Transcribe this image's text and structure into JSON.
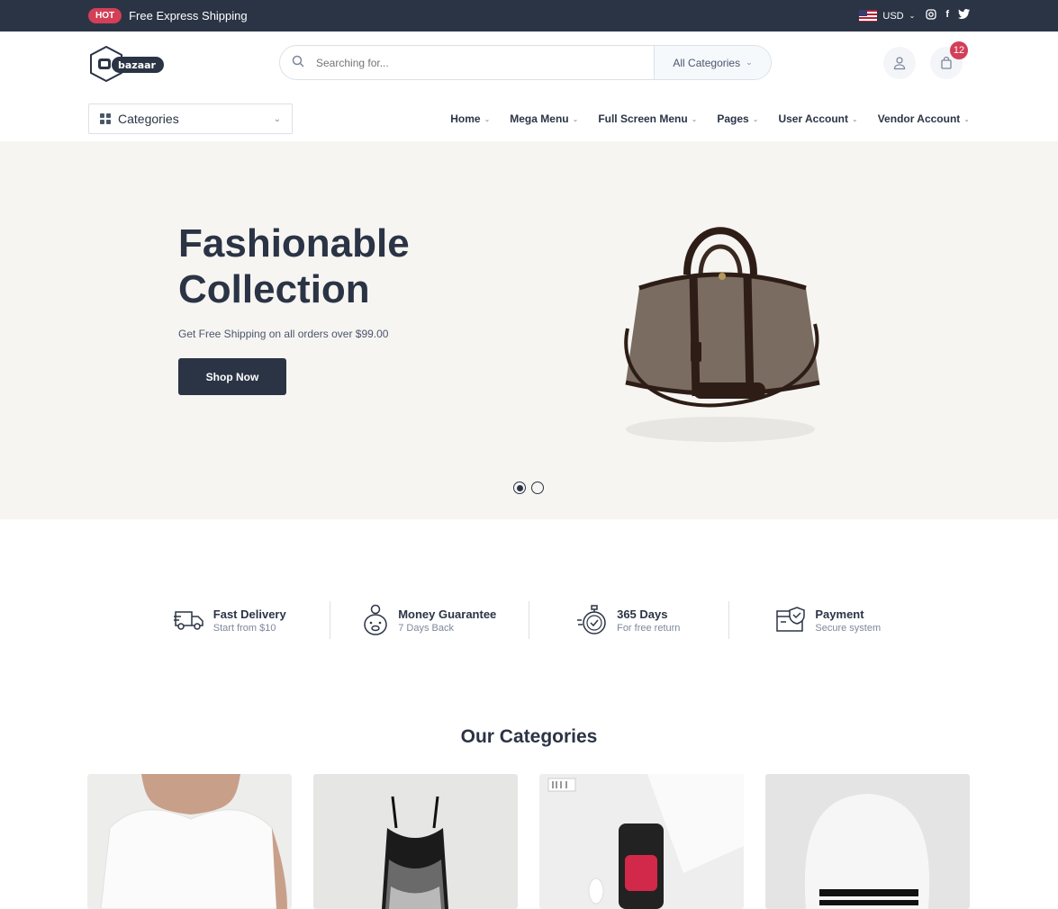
{
  "topbar": {
    "badge": "HOT",
    "promo": "Free Express Shipping",
    "currency": "USD"
  },
  "search": {
    "placeholder": "Searching for...",
    "category": "All Categories"
  },
  "cart": {
    "count": "12"
  },
  "nav": {
    "categories_label": "Categories",
    "menu": [
      "Home",
      "Mega Menu",
      "Full Screen Menu",
      "Pages",
      "User Account",
      "Vendor Account"
    ]
  },
  "hero": {
    "title": "Fashionable Collection",
    "subtitle": "Get Free Shipping on all orders over $99.00",
    "cta": "Shop Now",
    "slides": 2,
    "active_slide": 1
  },
  "services": [
    {
      "title": "Fast Delivery",
      "sub": "Start from $10"
    },
    {
      "title": "Money Guarantee",
      "sub": "7 Days Back"
    },
    {
      "title": "365 Days",
      "sub": "For free return"
    },
    {
      "title": "Payment",
      "sub": "Secure system"
    }
  ],
  "categories_section": {
    "title": "Our Categories"
  }
}
